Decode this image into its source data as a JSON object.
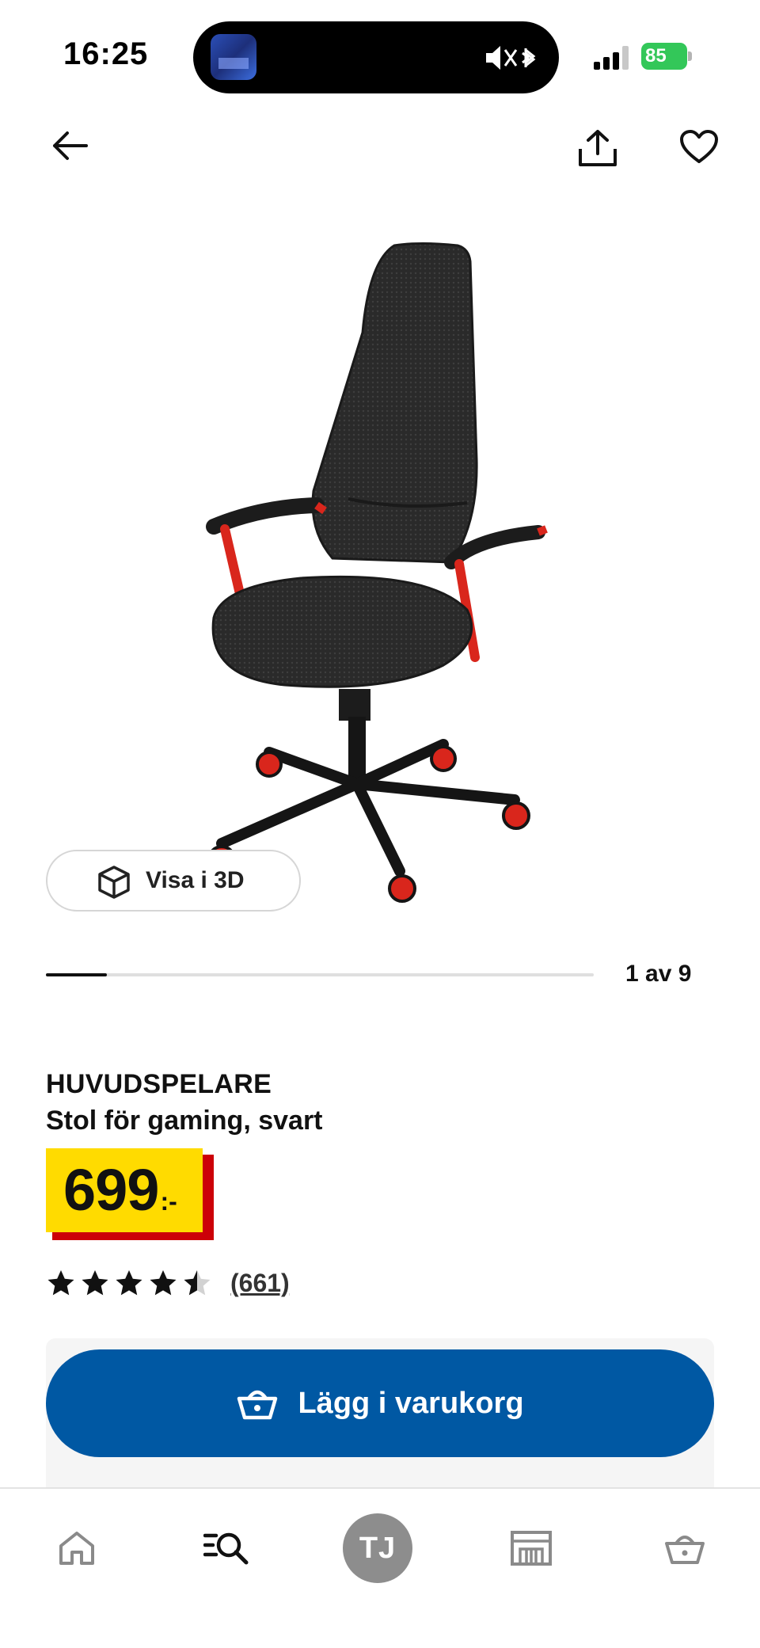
{
  "status_bar": {
    "time": "16:25",
    "battery_percent": "85",
    "battery_color": "#33c759"
  },
  "top_nav": {
    "back_icon": "arrow-left-icon",
    "share_icon": "share-icon",
    "favorite_icon": "heart-icon"
  },
  "gallery": {
    "view_3d_label": "Visa i 3D",
    "counter": "1 av 9",
    "current_index": 1,
    "total": 9
  },
  "product": {
    "name": "HUVUDSPELARE",
    "description": "Stol för gaming, svart",
    "price": "699",
    "price_suffix": ":-",
    "price_bg_color": "#ffdb00",
    "price_accent_color": "#cc0008",
    "rating": 4.5,
    "rating_max": 5,
    "review_count": "(661)"
  },
  "actions": {
    "add_to_cart_label": "Lägg i varukorg",
    "button_color": "#0058a3"
  },
  "bottom_nav": {
    "items": [
      {
        "name": "home",
        "icon": "home-icon"
      },
      {
        "name": "search",
        "icon": "search-icon"
      },
      {
        "name": "profile",
        "initials": "TJ"
      },
      {
        "name": "store",
        "icon": "store-icon"
      },
      {
        "name": "cart",
        "icon": "cart-icon"
      }
    ]
  }
}
